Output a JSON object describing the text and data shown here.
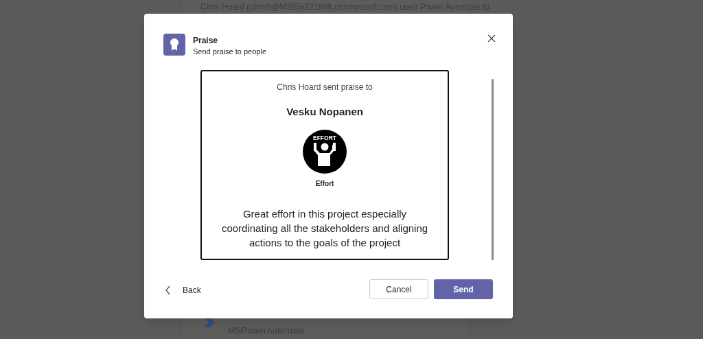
{
  "background_feed": {
    "notice": "Chris Hoard (chrish@M365x821868.onmicrosoft.com) used Power Automate to",
    "sender_handle": "MSPowerAutomate"
  },
  "dialog": {
    "title": "Praise",
    "subtitle": "Send praise to people",
    "card": {
      "intro": "Chris Hoard sent praise to",
      "recipient": "Vesku Nopanen",
      "badge_caption": "EFFORT",
      "badge_name": "Effort",
      "message": "Great effort in this project especially coordinating all the stakeholders and aligning actions to the goals of the project"
    },
    "back": "Back",
    "buttons": [
      {
        "label": "Cancel",
        "kind": "secondary"
      },
      {
        "label": "Send",
        "kind": "primary"
      }
    ]
  }
}
